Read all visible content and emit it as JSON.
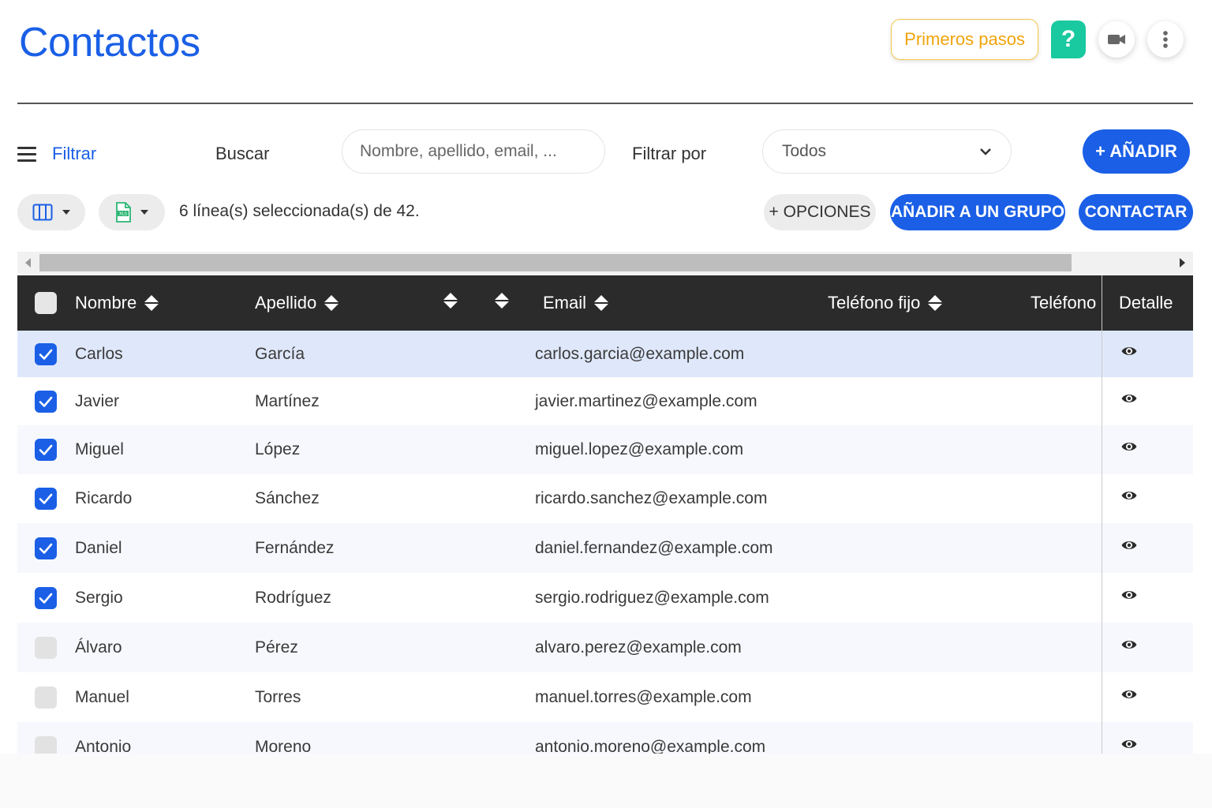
{
  "header": {
    "title": "Contactos",
    "first_steps_label": "Primeros pasos",
    "help_label": "?"
  },
  "filter_bar": {
    "filter_link": "Filtrar",
    "search_label": "Buscar",
    "search_placeholder": "Nombre, apellido, email, ...",
    "filter_by_label": "Filtrar por",
    "filter_by_value": "Todos",
    "add_button": "+ AÑADIR"
  },
  "toolbar": {
    "selection_info": "6 línea(s) seleccionada(s) de 42.",
    "options_button": "+ OPCIONES",
    "add_to_group_button": "AÑADIR A UN GRUPO",
    "contact_button": "CONTACTAR"
  },
  "table": {
    "columns": {
      "first_name": "Nombre",
      "last_name": "Apellido",
      "email": "Email",
      "landline": "Teléfono fijo",
      "mobile": "Teléfono m",
      "detail": "Detalle"
    },
    "rows": [
      {
        "first_name": "Carlos",
        "last_name": "García",
        "email": "carlos.garcia@example.com",
        "checked": true
      },
      {
        "first_name": "Javier",
        "last_name": "Martínez",
        "email": "javier.martinez@example.com",
        "checked": true
      },
      {
        "first_name": "Miguel",
        "last_name": "López",
        "email": "miguel.lopez@example.com",
        "checked": true
      },
      {
        "first_name": "Ricardo",
        "last_name": "Sánchez",
        "email": "ricardo.sanchez@example.com",
        "checked": true
      },
      {
        "first_name": "Daniel",
        "last_name": "Fernández",
        "email": "daniel.fernandez@example.com",
        "checked": true
      },
      {
        "first_name": "Sergio",
        "last_name": "Rodríguez",
        "email": "sergio.rodriguez@example.com",
        "checked": true
      },
      {
        "first_name": "Álvaro",
        "last_name": "Pérez",
        "email": "alvaro.perez@example.com",
        "checked": false
      },
      {
        "first_name": "Manuel",
        "last_name": "Torres",
        "email": "manuel.torres@example.com",
        "checked": false
      },
      {
        "first_name": "Antonio",
        "last_name": "Moreno",
        "email": "antonio.moreno@example.com",
        "checked": false
      }
    ]
  },
  "icons": {
    "menu": "menu-icon",
    "video": "video-camera-icon",
    "more": "more-vertical-icon",
    "columns": "columns-icon",
    "excel": "xls-file-icon",
    "detail": "eye-icon"
  },
  "colors": {
    "accent": "#1a5fe6",
    "help": "#19c9a0",
    "first_steps": "#f0a40b",
    "header_bg": "#2b2b2b",
    "row_highlight": "#dfe8fb",
    "row_alt": "#f6f8fd"
  }
}
